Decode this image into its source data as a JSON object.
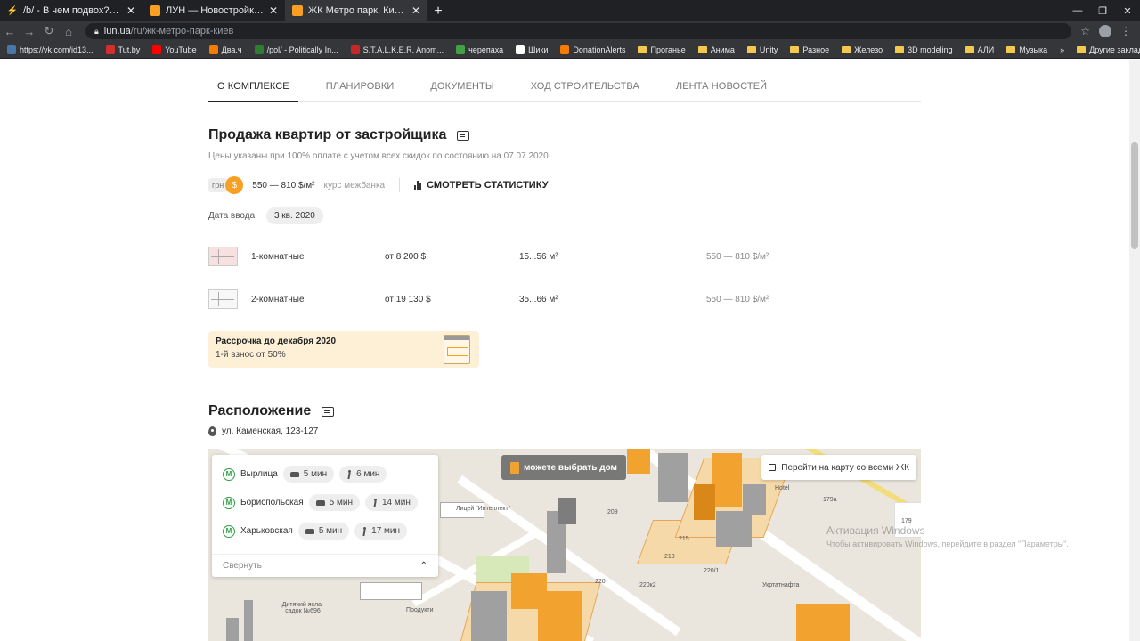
{
  "browser": {
    "tabs": [
      {
        "title": "/b/ - В чем подвох? Недвижка в",
        "icon_color": "#f7a021"
      },
      {
        "title": "ЛУН — Новостройки Киева, кв",
        "icon_color": "#f7a021"
      },
      {
        "title": "ЖК Метро парк, Киев — Квартир",
        "icon_color": "#f7a021"
      }
    ],
    "url_domain": "lun.ua",
    "url_path": "/ru/жк-метро-парк-киев",
    "bookmarks": [
      {
        "label": "https://vk.com/id13...",
        "color": "#4a76a8"
      },
      {
        "label": "Tut.by",
        "color": "#d32f2f"
      },
      {
        "label": "YouTube",
        "color": "#ff0000"
      },
      {
        "label": "Два.ч",
        "color": "#f57c00"
      },
      {
        "label": "/pol/ - Politically In...",
        "color": "#2e7d32"
      },
      {
        "label": "S.T.A.L.K.E.R. Anom...",
        "color": "#c62828"
      },
      {
        "label": "черепаха",
        "color": "#43a047"
      },
      {
        "label": "Шики",
        "color": "#ffffff"
      },
      {
        "label": "DonationAlerts",
        "color": "#f57c00"
      },
      {
        "label": "Проганье",
        "color": "folder"
      },
      {
        "label": "Анима",
        "color": "folder"
      },
      {
        "label": "Unity",
        "color": "folder"
      },
      {
        "label": "Разное",
        "color": "folder"
      },
      {
        "label": "Железо",
        "color": "folder"
      },
      {
        "label": "3D modeling",
        "color": "folder"
      },
      {
        "label": "АЛИ",
        "color": "folder"
      },
      {
        "label": "Музыка",
        "color": "folder"
      }
    ],
    "more_label": "»",
    "other_bookmarks": "Другие закладки"
  },
  "subnav": [
    "О КОМПЛЕКСЕ",
    "ПЛАНИРОВКИ",
    "ДОКУМЕНТЫ",
    "ХОД СТРОИТЕЛЬСТВА",
    "ЛЕНТА НОВОСТЕЙ"
  ],
  "sales": {
    "title": "Продажа квартир от застройщика",
    "subtitle": "Цены указаны при 100% оплате с учетом всех скидок по состоянию на 07.07.2020",
    "currency_grn": "грн",
    "currency_usd": "$",
    "price_range": "550 — 810 $/м²",
    "rate": "курс межбанка",
    "stats_label": "СМОТРЕТЬ СТАТИСТИКУ",
    "date_label": "Дата ввода:",
    "date_value": "3 кв. 2020",
    "apartments": [
      {
        "name": "1-комнатные",
        "price": "от 8 200 $",
        "area": "15...56 м²",
        "per_m2": "550 — 810 $/м²"
      },
      {
        "name": "2-комнатные",
        "price": "от 19 130 $",
        "area": "35...66 м²",
        "per_m2": "550 — 810 $/м²"
      }
    ],
    "promo_title": "Рассрочка до декабря 2020",
    "promo_sub": "1-й взнос от 50%"
  },
  "location": {
    "title": "Расположение",
    "address": "ул. Каменская, 123-127",
    "metro": [
      {
        "station": "Вырлица",
        "car": "5 мин",
        "walk": "6 мин"
      },
      {
        "station": "Бориспольская",
        "car": "5 мин",
        "walk": "14 мин"
      },
      {
        "station": "Харьковская",
        "car": "5 мин",
        "walk": "17 мин"
      }
    ],
    "collapse": "Свернуть",
    "choose_house": "можете выбрать дом",
    "all_map": "Перейти на карту со всеми ЖК",
    "map_labels": [
      "Лицей \"Интеллект\"",
      "Дитячий ясла-садок №696",
      "Продукти",
      "Укртатнафта",
      "209",
      "213",
      "215",
      "220",
      "220/1",
      "220к2",
      "179",
      "179а",
      "Hotel"
    ]
  },
  "watermark": {
    "line1": "Активация Windows",
    "line2": "Чтобы активировать Windows, перейдите в раздел \"Параметры\"."
  }
}
